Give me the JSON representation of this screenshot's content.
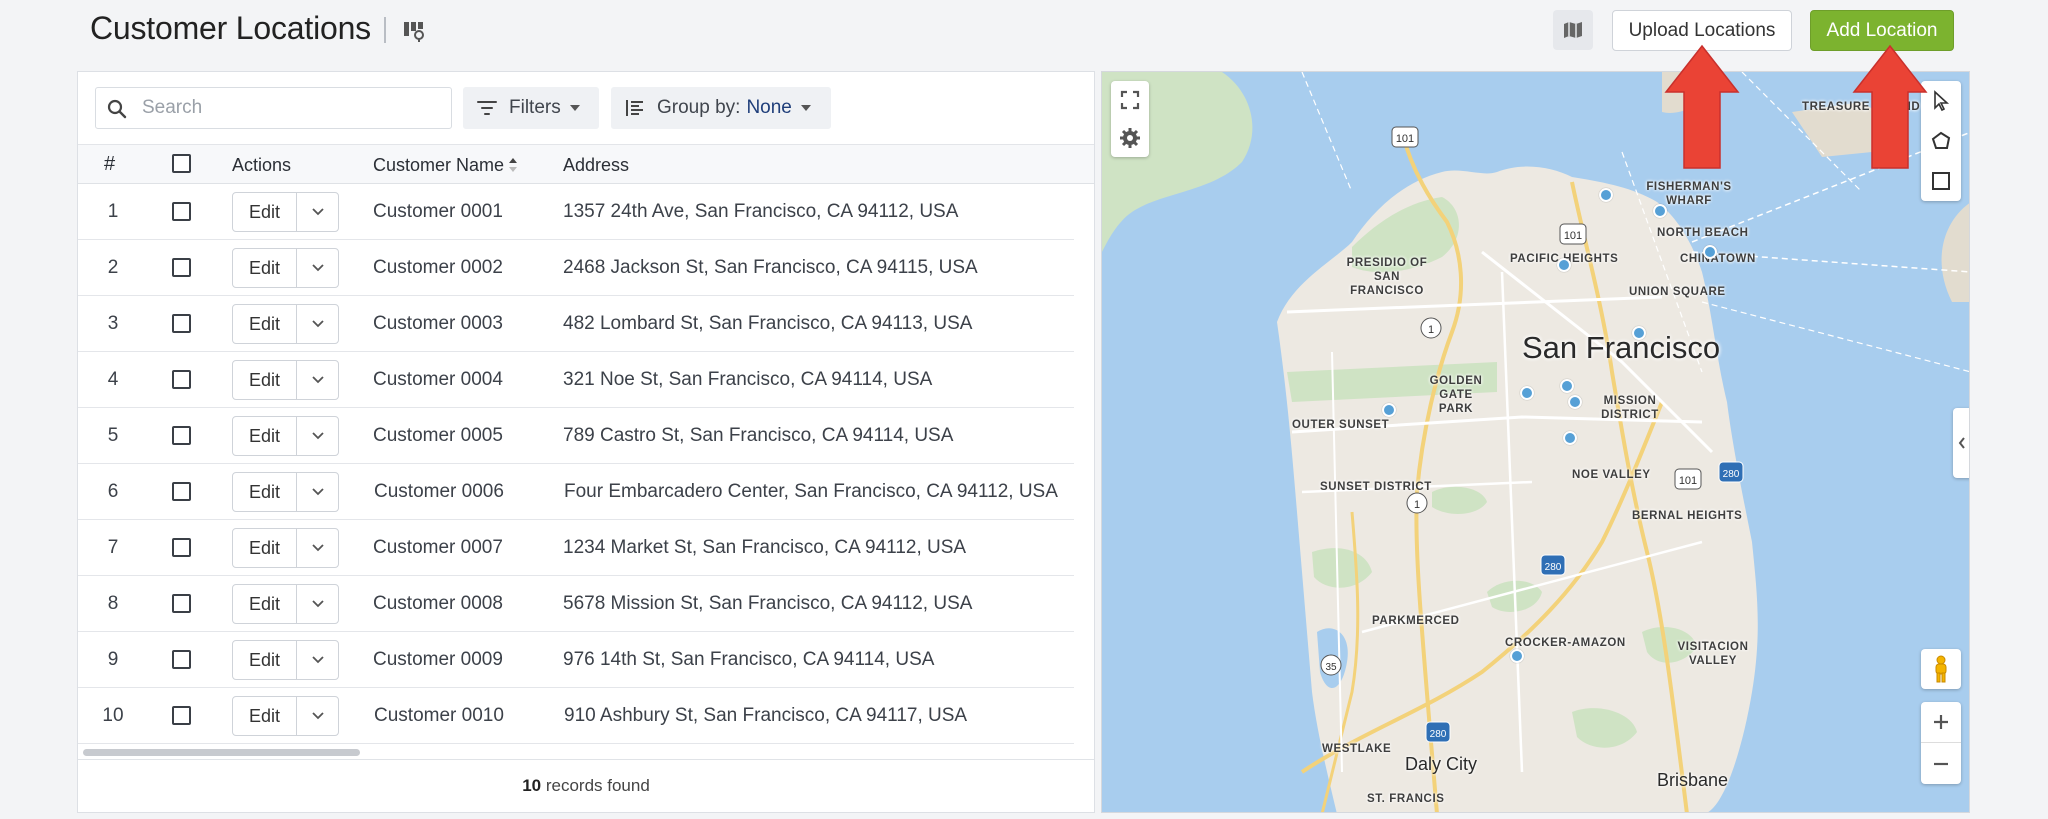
{
  "header": {
    "title": "Customer Locations",
    "upload_label": "Upload Locations",
    "add_label": "Add Location",
    "add_color": "#7cb32f"
  },
  "toolbar": {
    "search_placeholder": "Search",
    "filters_label": "Filters",
    "groupby_label": "Group by:",
    "groupby_value": "None"
  },
  "table": {
    "columns": [
      "#",
      "Actions",
      "Customer Name",
      "Address"
    ],
    "edit_label": "Edit",
    "rows": [
      {
        "num": "1",
        "name": "Customer 0001",
        "address": "1357 24th Ave, San Francisco, CA 94112, USA"
      },
      {
        "num": "2",
        "name": "Customer 0002",
        "address": "2468 Jackson St, San Francisco, CA 94115, USA"
      },
      {
        "num": "3",
        "name": "Customer 0003",
        "address": "482 Lombard St, San Francisco, CA 94113, USA"
      },
      {
        "num": "4",
        "name": "Customer 0004",
        "address": "321 Noe St, San Francisco, CA 94114, USA"
      },
      {
        "num": "5",
        "name": "Customer 0005",
        "address": "789 Castro St, San Francisco, CA 94114, USA"
      },
      {
        "num": "6",
        "name": "Customer 0006",
        "address": "Four Embarcadero Center, San Francisco, CA 94112, USA"
      },
      {
        "num": "7",
        "name": "Customer 0007",
        "address": "1234 Market St, San Francisco, CA 94112, USA"
      },
      {
        "num": "8",
        "name": "Customer 0008",
        "address": "5678 Mission St, San Francisco, CA 94112, USA"
      },
      {
        "num": "9",
        "name": "Customer 0009",
        "address": "976 14th St, San Francisco, CA 94114, USA"
      },
      {
        "num": "10",
        "name": "Customer 0010",
        "address": "910 Ashbury St, San Francisco, CA 94117, USA"
      }
    ],
    "footer_count": "10",
    "footer_text": " records found"
  },
  "map": {
    "city": "San Francisco",
    "labels": {
      "treasure_island": "TREASURE ISLAND",
      "fishermans_wharf": "FISHERMAN'S WHARF",
      "north_beach": "NORTH BEACH",
      "chinatown": "CHINATOWN",
      "pacific_heights": "PACIFIC HEIGHTS",
      "presidio": "PRESIDIO OF SAN FRANCISCO",
      "union_square": "UNION SQUARE",
      "golden_gate_park": "GOLDEN GATE PARK",
      "mission_district": "MISSION DISTRICT",
      "outer_sunset": "OUTER SUNSET",
      "noe_valley": "NOE VALLEY",
      "sunset_district": "SUNSET DISTRICT",
      "bernal_heights": "BERNAL HEIGHTS",
      "parkmerced": "PARKMERCED",
      "crocker_amazon": "CROCKER-AMAZON",
      "visitacion_valley": "VISITACION VALLEY",
      "westlake": "WESTLAKE",
      "st_francis": "ST. FRANCIS",
      "daly_city": "Daly City",
      "brisbane": "Brisbane"
    },
    "shields": [
      "101",
      "101",
      "101",
      "1",
      "1",
      "280",
      "280",
      "280",
      "35"
    ],
    "water_color": "#a8cdee",
    "land_color": "#ede9e2"
  },
  "annotations": {
    "arrow_color": "#ea4335"
  }
}
